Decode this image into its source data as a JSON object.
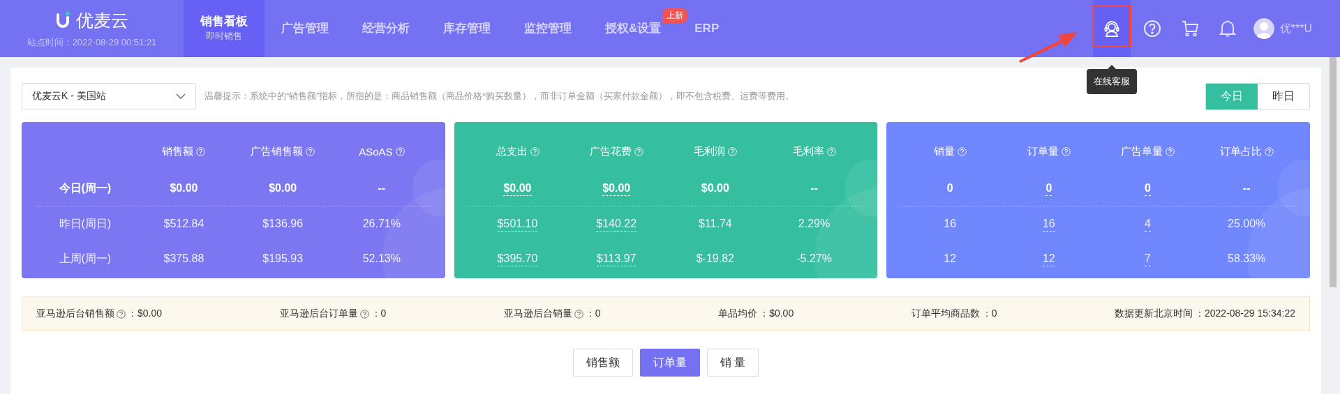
{
  "header": {
    "logo_text": "优麦云",
    "site_time": "站点时间：2022-08-29 00:51:21",
    "nav": [
      {
        "label": "销售看板",
        "sublabel": "即时销售",
        "selected": true
      },
      {
        "label": "广告管理",
        "selected": false
      },
      {
        "label": "经营分析",
        "selected": false
      },
      {
        "label": "库存管理",
        "selected": false
      },
      {
        "label": "监控管理",
        "selected": false
      },
      {
        "label": "授权&设置",
        "selected": false,
        "badge": "上新"
      },
      {
        "label": "ERP",
        "selected": false
      }
    ],
    "user_name": "优***U",
    "tooltip": "在线客服"
  },
  "toolbar": {
    "store_select": "优麦云K - 美国站",
    "hint": "温馨提示：系统中的“销售额”指标，所指的是：商品销售额（商品价格*购买数量），而非订单金额（买家付款金额），即不包含税费、运费等费用。",
    "day_toggle": [
      {
        "label": "今日",
        "selected": true
      },
      {
        "label": "昨日",
        "selected": false
      }
    ]
  },
  "panels": [
    {
      "color": "#7b77f2",
      "columns": [
        "销售额",
        "广告销售额",
        "ASoAS"
      ],
      "rows": [
        {
          "label": "今日(周一)",
          "bold": true,
          "cells": [
            {
              "value": "$0.00",
              "underlined": false
            },
            {
              "value": "$0.00",
              "underlined": false
            },
            {
              "value": "--",
              "underlined": false
            }
          ]
        },
        {
          "label": "昨日(周日)",
          "bold": false,
          "cells": [
            {
              "value": "$512.84",
              "underlined": false
            },
            {
              "value": "$136.96",
              "underlined": false
            },
            {
              "value": "26.71%",
              "underlined": false
            }
          ]
        },
        {
          "label": "上周(周一)",
          "bold": false,
          "cells": [
            {
              "value": "$375.88",
              "underlined": false
            },
            {
              "value": "$195.93",
              "underlined": false
            },
            {
              "value": "52.13%",
              "underlined": false
            }
          ]
        }
      ]
    },
    {
      "color": "#35bf9f",
      "columns": [
        "总支出",
        "广告花费",
        "毛利润",
        "毛利率"
      ],
      "rows": [
        {
          "bold": true,
          "cells": [
            {
              "value": "$0.00",
              "underlined": true
            },
            {
              "value": "$0.00",
              "underlined": true
            },
            {
              "value": "$0.00",
              "underlined": false
            },
            {
              "value": "--",
              "underlined": false
            }
          ]
        },
        {
          "bold": false,
          "cells": [
            {
              "value": "$501.10",
              "underlined": true
            },
            {
              "value": "$140.22",
              "underlined": true
            },
            {
              "value": "$11.74",
              "underlined": false
            },
            {
              "value": "2.29%",
              "underlined": false
            }
          ]
        },
        {
          "bold": false,
          "cells": [
            {
              "value": "$395.70",
              "underlined": true
            },
            {
              "value": "$113.97",
              "underlined": true
            },
            {
              "value": "$-19.82",
              "underlined": false
            },
            {
              "value": "-5.27%",
              "underlined": false
            }
          ]
        }
      ]
    },
    {
      "color": "#7086fc",
      "columns": [
        "销量",
        "订单量",
        "广告单量",
        "订单占比"
      ],
      "rows": [
        {
          "bold": true,
          "cells": [
            {
              "value": "0",
              "underlined": false
            },
            {
              "value": "0",
              "underlined": true
            },
            {
              "value": "0",
              "underlined": true
            },
            {
              "value": "--",
              "underlined": false
            }
          ]
        },
        {
          "bold": false,
          "cells": [
            {
              "value": "16",
              "underlined": false
            },
            {
              "value": "16",
              "underlined": true
            },
            {
              "value": "4",
              "underlined": true
            },
            {
              "value": "25.00%",
              "underlined": false
            }
          ]
        },
        {
          "bold": false,
          "cells": [
            {
              "value": "12",
              "underlined": false
            },
            {
              "value": "12",
              "underlined": true
            },
            {
              "value": "7",
              "underlined": true
            },
            {
              "value": "58.33%",
              "underlined": false
            }
          ]
        }
      ]
    }
  ],
  "summary": [
    {
      "label": "亚马逊后台销售额",
      "help": true,
      "value": "：$0.00"
    },
    {
      "label": "亚马逊后台订单量",
      "help": true,
      "value": "：0"
    },
    {
      "label": "亚马逊后台销量",
      "help": true,
      "value": "：0"
    },
    {
      "label": "单品均价",
      "help": false,
      "value": "：$0.00"
    },
    {
      "label": "订单平均商品数",
      "help": false,
      "value": "：0"
    },
    {
      "label": "数据更新北京时间",
      "help": false,
      "value": "：2022-08-29 15:34:22"
    }
  ],
  "metric_buttons": [
    {
      "label": "销售额",
      "selected": false
    },
    {
      "label": "订单量",
      "selected": true
    },
    {
      "label": "销 量",
      "selected": false
    }
  ]
}
